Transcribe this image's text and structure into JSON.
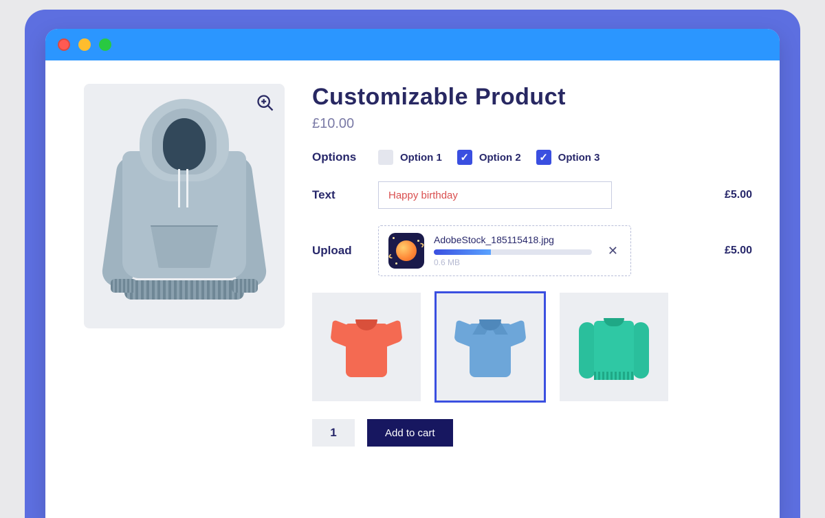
{
  "product": {
    "title": "Customizable Product",
    "price": "£10.00"
  },
  "options": {
    "label": "Options",
    "items": [
      {
        "label": "Option 1",
        "checked": false
      },
      {
        "label": "Option 2",
        "checked": true
      },
      {
        "label": "Option 3",
        "checked": true
      }
    ]
  },
  "text_field": {
    "label": "Text",
    "value": "Happy birthday",
    "price": "£5.00"
  },
  "upload": {
    "label": "Upload",
    "filename": "AdobeStock_185115418.jpg",
    "filesize": "0.6 MB",
    "progress_pct": 36,
    "price": "£5.00"
  },
  "variants": {
    "selected_index": 1
  },
  "actions": {
    "quantity": "1",
    "add_to_cart": "Add to cart"
  }
}
